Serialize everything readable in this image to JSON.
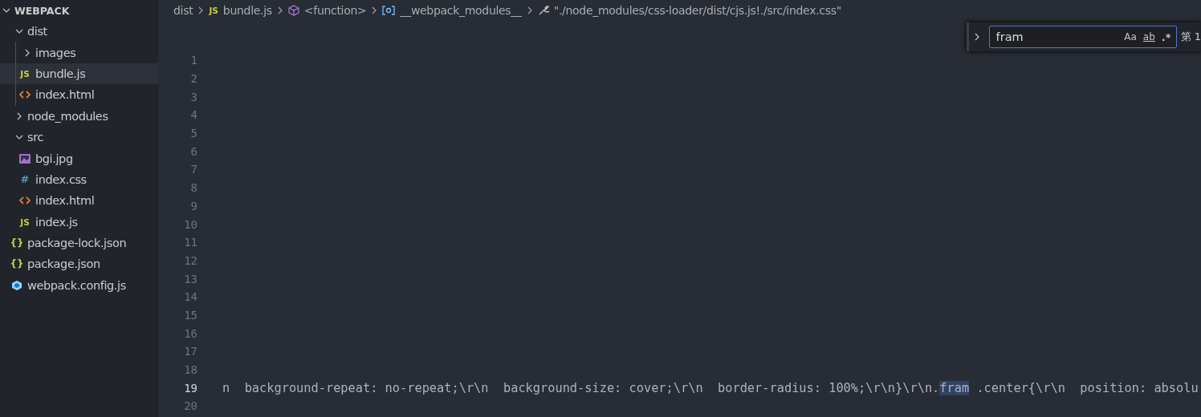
{
  "sidebar": {
    "title": "WEBPACK",
    "expanded": true,
    "items": [
      {
        "label": "dist",
        "kind": "folder",
        "expanded": true,
        "selected": false,
        "children": [
          {
            "label": "images",
            "kind": "folder",
            "expanded": false,
            "selected": false
          },
          {
            "label": "bundle.js",
            "kind": "js",
            "badge": "JS",
            "selected": true
          },
          {
            "label": "index.html",
            "kind": "html",
            "selected": false
          }
        ]
      },
      {
        "label": "node_modules",
        "kind": "folder",
        "expanded": false,
        "selected": false
      },
      {
        "label": "src",
        "kind": "folder",
        "expanded": true,
        "selected": false,
        "children": [
          {
            "label": "bgi.jpg",
            "kind": "image",
            "selected": false
          },
          {
            "label": "index.css",
            "kind": "css",
            "badge": "#",
            "selected": false
          },
          {
            "label": "index.html",
            "kind": "html",
            "selected": false
          },
          {
            "label": "index.js",
            "kind": "js",
            "badge": "JS",
            "selected": false
          }
        ]
      },
      {
        "label": "package-lock.json",
        "kind": "json",
        "badge": "{}",
        "selected": false
      },
      {
        "label": "package.json",
        "kind": "json",
        "badge": "{}",
        "selected": false
      },
      {
        "label": "webpack.config.js",
        "kind": "webpack",
        "selected": false
      }
    ]
  },
  "breadcrumb": [
    {
      "label": "dist",
      "kind": "folder"
    },
    {
      "label": "bundle.js",
      "kind": "js",
      "badge": "JS"
    },
    {
      "label": "<function>",
      "kind": "function"
    },
    {
      "label": "__webpack_modules__",
      "kind": "variable"
    },
    {
      "label": "\"./node_modules/css-loader/dist/cjs.js!./src/index.css\"",
      "kind": "string"
    }
  ],
  "find": {
    "expanded": false,
    "value": "fram",
    "options": [
      {
        "label": "Aa",
        "kind": "case"
      },
      {
        "label": "ab",
        "kind": "word"
      },
      {
        "label": ".*",
        "kind": "regex"
      }
    ],
    "result": "第 1"
  },
  "editor": {
    "lines": [
      {
        "number": "1",
        "active": false
      },
      {
        "number": "2",
        "active": false
      },
      {
        "number": "3",
        "active": false
      },
      {
        "number": "4",
        "active": false
      },
      {
        "number": "5",
        "active": false
      },
      {
        "number": "6",
        "active": false
      },
      {
        "number": "7",
        "active": false
      },
      {
        "number": "8",
        "active": false
      },
      {
        "number": "9",
        "active": false
      },
      {
        "number": "10",
        "active": false
      },
      {
        "number": "11",
        "active": false
      },
      {
        "number": "12",
        "active": false
      },
      {
        "number": "13",
        "active": false
      },
      {
        "number": "14",
        "active": false
      },
      {
        "number": "15",
        "active": false
      },
      {
        "number": "16",
        "active": false
      },
      {
        "number": "17",
        "active": false
      },
      {
        "number": "18",
        "active": false
      },
      {
        "number": "19",
        "active": true,
        "segments": [
          {
            "text": "n  background-repeat: no-repeat;\\r\\n  background-size: cover;\\r\\n  border-radius: 100%;\\r\\n}\\r\\n.",
            "match": false
          },
          {
            "text": "fram",
            "match": true
          },
          {
            "text": " .center{\\r\\n  position: absolu",
            "match": false
          }
        ]
      },
      {
        "number": "20",
        "active": false
      }
    ]
  }
}
